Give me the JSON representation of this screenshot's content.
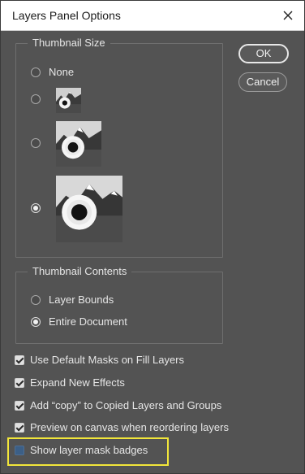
{
  "dialog": {
    "title": "Layers Panel Options",
    "close_icon": "close-icon"
  },
  "thumbnail_size": {
    "legend": "Thumbnail Size",
    "options": [
      {
        "label": "None",
        "selected": false
      },
      {
        "label": "",
        "size": "small",
        "selected": false
      },
      {
        "label": "",
        "size": "medium",
        "selected": false
      },
      {
        "label": "",
        "size": "large",
        "selected": true
      }
    ]
  },
  "thumbnail_contents": {
    "legend": "Thumbnail Contents",
    "options": [
      {
        "label": "Layer Bounds",
        "selected": false
      },
      {
        "label": "Entire Document",
        "selected": true
      }
    ]
  },
  "checkboxes": [
    {
      "label": "Use Default Masks on Fill Layers",
      "checked": true
    },
    {
      "label": "Expand New Effects",
      "checked": true
    },
    {
      "label": "Add “copy” to Copied Layers and Groups",
      "checked": true
    },
    {
      "label": "Preview on canvas when reordering layers",
      "checked": true
    },
    {
      "label": "Show layer mask badges",
      "checked": false
    }
  ],
  "buttons": {
    "ok": "OK",
    "cancel": "Cancel"
  },
  "colors": {
    "dialog_bg": "#535353",
    "highlight": "#f2e63a",
    "unchecked_box": "#3c5f86"
  }
}
